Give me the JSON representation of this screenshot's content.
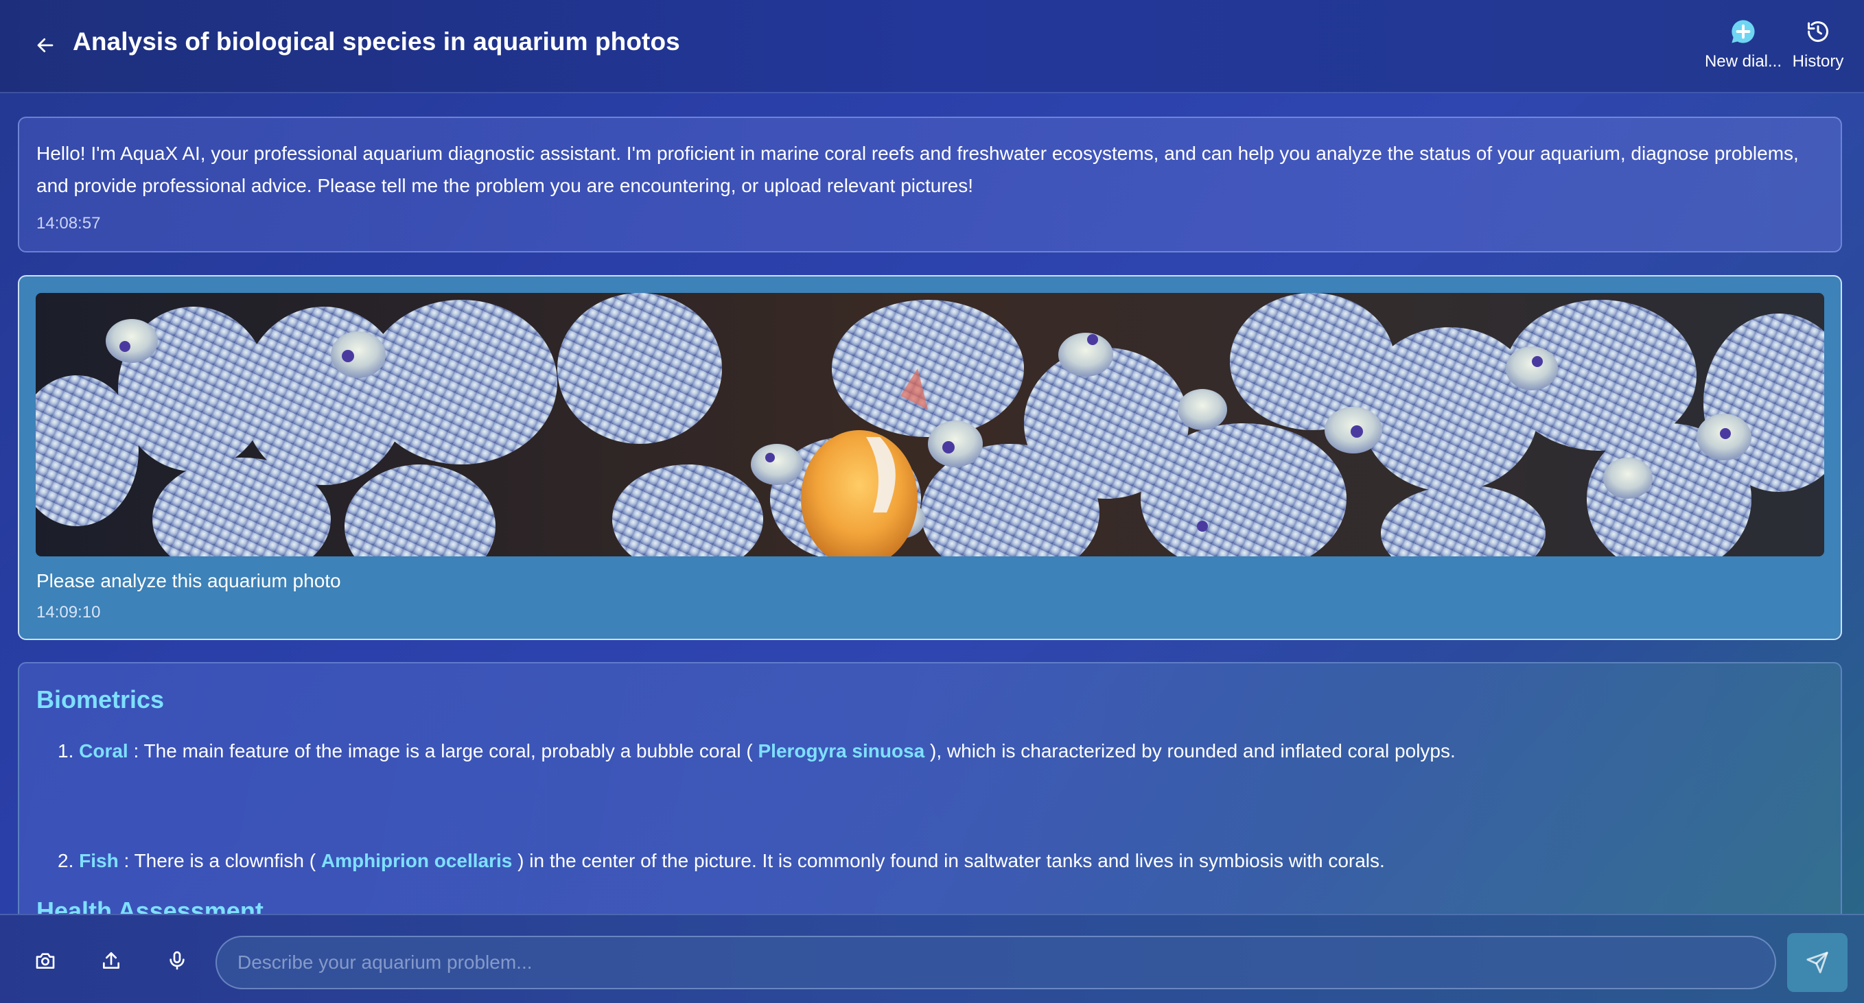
{
  "header": {
    "title": "Analysis of biological species in aquarium photos",
    "back_icon": "arrow-left-icon",
    "actions": [
      {
        "label": "New dial...",
        "icon": "chat-plus-icon"
      },
      {
        "label": "History",
        "icon": "history-clock-icon"
      }
    ]
  },
  "messages": {
    "welcome": {
      "text": "Hello! I'm AquaX AI, your professional aquarium diagnostic assistant. I'm proficient in marine coral reefs and freshwater ecosystems, and can help you analyze the status of your aquarium, diagnose problems, and provide professional advice. Please tell me the problem you are encountering, or upload relevant pictures!",
      "time": "14:08:57"
    },
    "user": {
      "text": "Please analyze this aquarium photo",
      "time": "14:09:10"
    },
    "analysis": {
      "biometrics_title": "Biometrics",
      "items": [
        {
          "num": "1.",
          "name": "Coral",
          "pre": " : The main feature of the image is a large coral, probably a bubble coral ( ",
          "species": "Plerogyra sinuosa",
          "post": " ), which is characterized by rounded and inflated coral polyps."
        },
        {
          "num": "2.",
          "name": "Fish",
          "pre": " : There is a clownfish ( ",
          "species": "Amphiprion ocellaris",
          "post": " ) in the center of the picture. It is commonly found in saltwater tanks and lives in symbiosis with corals."
        }
      ],
      "health_title": "Health Assessment"
    }
  },
  "input": {
    "placeholder": "Describe your aquarium problem...",
    "value": ""
  },
  "toolbar_icons": [
    "camera-icon",
    "upload-icon",
    "microphone-icon",
    "send-icon"
  ],
  "colors": {
    "accent": "#7ee0ff",
    "header_bg": "#1d2f7c",
    "user_bubble": "#3d82b8",
    "send_button": "#3e88b0"
  }
}
